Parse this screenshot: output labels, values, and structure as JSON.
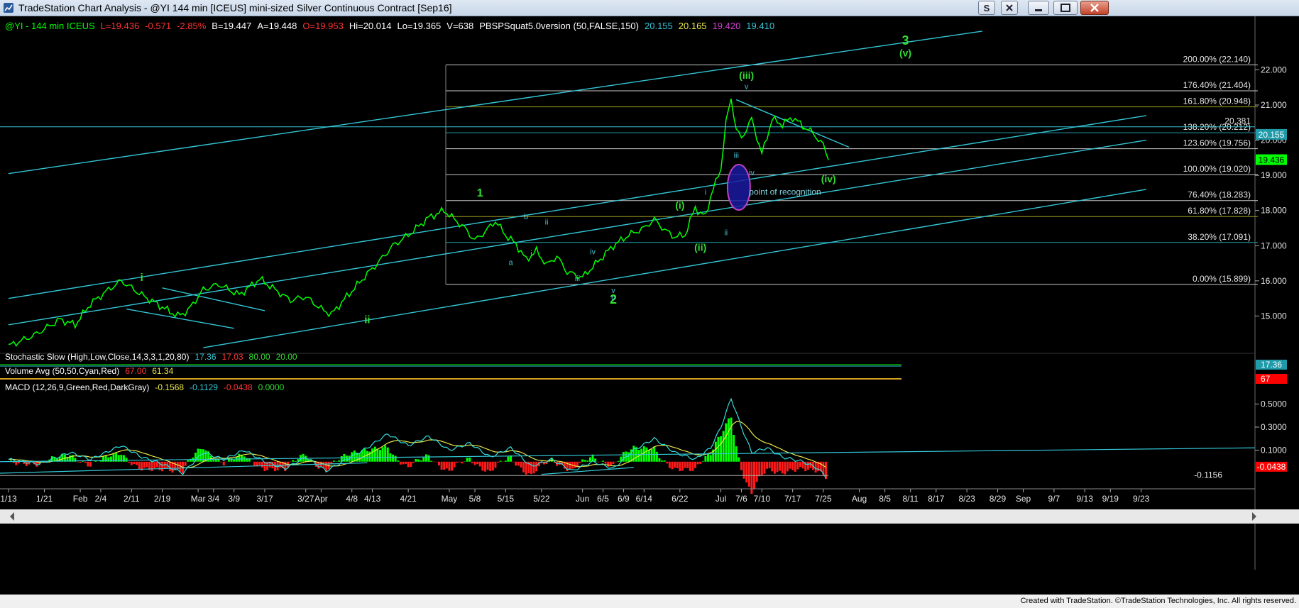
{
  "window": {
    "title": "TradeStation Chart Analysis - @YI 144 min [ICEUS] mini-sized Silver Continuous Contract [Sep16]",
    "footer_credit": "Created with TradeStation. ©TradeStation Technologies, Inc. All rights reserved."
  },
  "colors": {
    "background": "#000000",
    "price": "#00ff00",
    "channel": "#33c6d6",
    "fib_line": "#c8c8c8",
    "fib_line_olive": "#9c9c20",
    "fib_line_teal": "#1f9aa8",
    "wave_major": "#33dd33",
    "wave_minor": "#44bfd0",
    "macd_line": "#33dddd",
    "signal_line": "#e8e84a",
    "hist_pos": "#00ff00",
    "hist_neg": "#ff1a1a"
  },
  "header": [
    {
      "text": "@YI - 144 min ICEUS",
      "color": "#00ff00"
    },
    {
      "text": "L=19.436",
      "color": "#ff3333"
    },
    {
      "text": "-0.571",
      "color": "#ff3333"
    },
    {
      "text": "-2.85%",
      "color": "#ff3333"
    },
    {
      "text": "B=19.447",
      "color": "#ffffff"
    },
    {
      "text": "A=19.448",
      "color": "#ffffff"
    },
    {
      "text": "O=19.953",
      "color": "#ff3333"
    },
    {
      "text": "Hi=20.014",
      "color": "#ffffff"
    },
    {
      "text": "Lo=19.365",
      "color": "#ffffff"
    },
    {
      "text": "V=638",
      "color": "#ffffff"
    },
    {
      "text": "PBSPSquat5.0version (50,FALSE,150)",
      "color": "#ffffff"
    },
    {
      "text": "20.155",
      "color": "#33c6d6"
    },
    {
      "text": "20.165",
      "color": "#e8e84a"
    },
    {
      "text": "19.420",
      "color": "#d040d0"
    },
    {
      "text": "19.410",
      "color": "#33c6d6"
    }
  ],
  "chart_data": {
    "type": "line",
    "symbol": "@YI",
    "interval": "144 min",
    "price_axis": {
      "ticks": [
        15.0,
        16.0,
        17.0,
        18.0,
        19.0,
        20.0,
        21.0,
        22.0
      ],
      "ylim": [
        14.0,
        23.3
      ],
      "tick_labels": [
        "15.000",
        "16.000",
        "17.000",
        "18.000",
        "19.000",
        "20.000",
        "21.000",
        "22.000"
      ]
    },
    "price_markers": [
      {
        "label": "20.155",
        "value": 20.155,
        "bg": "#1f9aa8",
        "fg": "#ffffff"
      },
      {
        "label": "19.436",
        "value": 19.436,
        "bg": "#00ff00",
        "fg": "#000000"
      }
    ],
    "x_ticks": [
      "1/13",
      "1/21",
      "Feb",
      "2/4",
      "2/11",
      "2/19",
      "Mar",
      "3/4",
      "3/9",
      "3/17",
      "3/27",
      "Apr",
      "4/8",
      "4/13",
      "4/21",
      "May",
      "5/8",
      "5/15",
      "5/22",
      "Jun",
      "6/5",
      "6/9",
      "6/14",
      "6/22",
      "Jul",
      "7/6",
      "7/10",
      "7/17",
      "7/25",
      "Aug",
      "8/5",
      "8/11",
      "8/17",
      "8/23",
      "8/29",
      "Sep",
      "9/7",
      "9/13",
      "9/19",
      "9/23"
    ],
    "x_tick_index": [
      0,
      7,
      14,
      18,
      24,
      30,
      37,
      40,
      44,
      50,
      58,
      61,
      67,
      71,
      78,
      86,
      91,
      97,
      104,
      112,
      116,
      120,
      124,
      131,
      139,
      143,
      147,
      153,
      159,
      166,
      171,
      176,
      181,
      187,
      193,
      198,
      204,
      210,
      215,
      221
    ],
    "price_series": [
      {
        "i": 0,
        "y": 14.15
      },
      {
        "i": 5,
        "y": 14.45
      },
      {
        "i": 10,
        "y": 14.9
      },
      {
        "i": 13,
        "y": 14.75
      },
      {
        "i": 16,
        "y": 15.35
      },
      {
        "i": 20,
        "y": 15.8
      },
      {
        "i": 22,
        "y": 16.0
      },
      {
        "i": 26,
        "y": 15.6
      },
      {
        "i": 30,
        "y": 15.25
      },
      {
        "i": 33,
        "y": 15.0
      },
      {
        "i": 35,
        "y": 15.15
      },
      {
        "i": 38,
        "y": 15.75
      },
      {
        "i": 41,
        "y": 15.9
      },
      {
        "i": 45,
        "y": 15.6
      },
      {
        "i": 49,
        "y": 16.05
      },
      {
        "i": 52,
        "y": 15.75
      },
      {
        "i": 55,
        "y": 15.45
      },
      {
        "i": 58,
        "y": 15.55
      },
      {
        "i": 61,
        "y": 15.2
      },
      {
        "i": 63,
        "y": 15.05
      },
      {
        "i": 66,
        "y": 15.55
      },
      {
        "i": 70,
        "y": 16.2
      },
      {
        "i": 72,
        "y": 16.5
      },
      {
        "i": 75,
        "y": 17.0
      },
      {
        "i": 78,
        "y": 17.3
      },
      {
        "i": 80,
        "y": 17.55
      },
      {
        "i": 82,
        "y": 17.8
      },
      {
        "i": 85,
        "y": 18.0
      },
      {
        "i": 87,
        "y": 17.75
      },
      {
        "i": 89,
        "y": 17.5
      },
      {
        "i": 91,
        "y": 17.15
      },
      {
        "i": 93,
        "y": 17.4
      },
      {
        "i": 95,
        "y": 17.7
      },
      {
        "i": 97,
        "y": 17.3
      },
      {
        "i": 99,
        "y": 17.05
      },
      {
        "i": 101,
        "y": 16.6
      },
      {
        "i": 103,
        "y": 16.85
      },
      {
        "i": 105,
        "y": 16.45
      },
      {
        "i": 107,
        "y": 16.7
      },
      {
        "i": 109,
        "y": 16.25
      },
      {
        "i": 112,
        "y": 16.1
      },
      {
        "i": 115,
        "y": 16.55
      },
      {
        "i": 118,
        "y": 17.0
      },
      {
        "i": 121,
        "y": 17.3
      },
      {
        "i": 124,
        "y": 17.5
      },
      {
        "i": 126,
        "y": 17.75
      },
      {
        "i": 128,
        "y": 17.45
      },
      {
        "i": 130,
        "y": 17.25
      },
      {
        "i": 132,
        "y": 17.3
      },
      {
        "i": 134,
        "y": 18.1
      },
      {
        "i": 135,
        "y": 17.9
      },
      {
        "i": 136,
        "y": 17.85
      },
      {
        "i": 137,
        "y": 18.4
      },
      {
        "i": 139,
        "y": 19.2
      },
      {
        "i": 140,
        "y": 20.5
      },
      {
        "i": 141,
        "y": 21.2
      },
      {
        "i": 142,
        "y": 20.3
      },
      {
        "i": 143,
        "y": 20.05
      },
      {
        "i": 145,
        "y": 20.6
      },
      {
        "i": 147,
        "y": 19.6
      },
      {
        "i": 149,
        "y": 20.6
      },
      {
        "i": 151,
        "y": 20.45
      },
      {
        "i": 153,
        "y": 20.65
      },
      {
        "i": 155,
        "y": 20.4
      },
      {
        "i": 157,
        "y": 20.2
      },
      {
        "i": 159,
        "y": 19.85
      },
      {
        "i": 160,
        "y": 19.436
      }
    ],
    "fib_levels": [
      {
        "label": "200.00% (22.140)",
        "value": 22.14,
        "style": "fib_line"
      },
      {
        "label": "176.40% (21.404)",
        "value": 21.404,
        "style": "fib_line"
      },
      {
        "label": "161.80% (20.948)",
        "value": 20.948,
        "style": "fib_line_olive"
      },
      {
        "label": "138.20% (20.212)",
        "value": 20.212,
        "style": "fib_line_teal"
      },
      {
        "label": "123.60% (19.756)",
        "value": 19.756,
        "style": "fib_line"
      },
      {
        "label": "100.00% (19.020)",
        "value": 19.02,
        "style": "fib_line"
      },
      {
        "label": "76.40% (18.283)",
        "value": 18.283,
        "style": "fib_line"
      },
      {
        "label": "61.80% (17.828)",
        "value": 17.828,
        "style": "fib_line_olive"
      },
      {
        "label": "38.20% (17.091)",
        "value": 17.091,
        "style": "fib_line_teal"
      },
      {
        "label": "0.00% (15.899)",
        "value": 15.899,
        "style": "fib_line"
      }
    ],
    "horizontal_line": {
      "label": "20.381",
      "value": 20.381
    },
    "channels": [
      {
        "from": {
          "i": 0,
          "y": 19.05
        },
        "to": {
          "i": 190,
          "y": 23.1
        }
      },
      {
        "from": {
          "i": 0,
          "y": 15.5
        },
        "to": {
          "i": 222,
          "y": 20.7
        }
      },
      {
        "from": {
          "i": 0,
          "y": 14.75
        },
        "to": {
          "i": 222,
          "y": 20.0
        }
      },
      {
        "from": {
          "i": 38,
          "y": 14.1
        },
        "to": {
          "i": 222,
          "y": 18.6
        }
      },
      {
        "from": {
          "i": 23,
          "y": 15.2
        },
        "to": {
          "i": 44,
          "y": 14.65
        }
      },
      {
        "from": {
          "i": 30,
          "y": 15.8
        },
        "to": {
          "i": 50,
          "y": 15.15
        }
      },
      {
        "from": {
          "i": 142,
          "y": 21.15
        },
        "to": {
          "i": 164,
          "y": 19.8
        }
      }
    ],
    "wave_labels": [
      {
        "text": "3",
        "i": 175,
        "y": 22.72,
        "color": "wave_major",
        "size": 18
      },
      {
        "text": "(v)",
        "i": 175,
        "y": 22.38,
        "color": "wave_major",
        "size": 14
      },
      {
        "text": "(iii)",
        "i": 144,
        "y": 21.75,
        "color": "wave_major",
        "size": 14
      },
      {
        "text": "v",
        "i": 144,
        "y": 21.45,
        "color": "wave_minor",
        "size": 11
      },
      {
        "text": "1",
        "i": 92,
        "y": 18.4,
        "color": "wave_major",
        "size": 16
      },
      {
        "text": "(i)",
        "i": 131,
        "y": 18.05,
        "color": "wave_major",
        "size": 14
      },
      {
        "text": "(ii)",
        "i": 135,
        "y": 16.85,
        "color": "wave_major",
        "size": 14
      },
      {
        "text": "(iv)",
        "i": 160,
        "y": 18.8,
        "color": "wave_major",
        "size": 14
      },
      {
        "text": "2",
        "i": 118,
        "y": 15.35,
        "color": "wave_major",
        "size": 18
      },
      {
        "text": "ii",
        "i": 70,
        "y": 14.8,
        "color": "wave_major",
        "size": 15
      },
      {
        "text": "i",
        "i": 26,
        "y": 16.0,
        "color": "wave_major",
        "size": 15
      },
      {
        "text": "a",
        "i": 98,
        "y": 16.45,
        "color": "wave_minor",
        "size": 11
      },
      {
        "text": "b",
        "i": 101,
        "y": 17.75,
        "color": "wave_minor",
        "size": 11
      },
      {
        "text": "c",
        "i": 118,
        "y": 15.45,
        "color": "wave_minor",
        "size": 11
      },
      {
        "text": "i",
        "i": 102,
        "y": 16.7,
        "color": "wave_minor",
        "size": 11
      },
      {
        "text": "ii",
        "i": 105,
        "y": 17.6,
        "color": "wave_minor",
        "size": 11
      },
      {
        "text": "iii",
        "i": 111,
        "y": 16.0,
        "color": "wave_minor",
        "size": 11
      },
      {
        "text": "iv",
        "i": 114,
        "y": 16.75,
        "color": "wave_minor",
        "size": 11
      },
      {
        "text": "v",
        "i": 118,
        "y": 15.65,
        "color": "wave_minor",
        "size": 11
      },
      {
        "text": "i",
        "i": 136,
        "y": 18.45,
        "color": "wave_minor",
        "size": 11
      },
      {
        "text": "ii",
        "i": 140,
        "y": 17.3,
        "color": "wave_minor",
        "size": 11
      },
      {
        "text": "iii",
        "i": 142,
        "y": 19.5,
        "color": "wave_minor",
        "size": 11
      },
      {
        "text": "iv",
        "i": 145,
        "y": 19.0,
        "color": "wave_minor",
        "size": 11
      }
    ],
    "annotation": {
      "text": "point of recognition",
      "i": 144.5,
      "y": 18.45
    },
    "ellipse": {
      "i": 142.5,
      "y": 18.66,
      "label": ""
    },
    "stochastic": {
      "label": "Stochastic Slow (High,Low,Close,14,3,3,1,20,80)",
      "values": [
        "17.36",
        "17.03",
        "80.00",
        "20.00"
      ],
      "value_colors": [
        "#33c6d6",
        "#ff3333",
        "#33dd33",
        "#33dd33"
      ],
      "axis_marker": "17.36"
    },
    "volume": {
      "label": "Volume Avg (50,50,Cyan,Red)",
      "values": [
        "67.00",
        "61.34"
      ],
      "value_colors": [
        "#ff3333",
        "#e8e84a"
      ],
      "axis_marker": "67"
    },
    "macd": {
      "label": "MACD (12,26,9,Green,Red,DarkGray)",
      "values": [
        "-0.1568",
        "-0.1129",
        "-0.0438",
        "0.0000"
      ],
      "value_colors": [
        "#e8e84a",
        "#33c6d6",
        "#ff3333",
        "#33dd33"
      ],
      "ticks": [
        0.5,
        0.3,
        0.1
      ],
      "tick_labels": [
        "0.5000",
        "0.3000",
        "0.1000"
      ],
      "ylim": [
        -0.18,
        0.62
      ],
      "axis_marker": "-0.0438",
      "level_line": {
        "label": "-0.1156",
        "value": -0.1156
      },
      "macd_series": [
        {
          "i": 0,
          "y": 0.02
        },
        {
          "i": 6,
          "y": -0.02
        },
        {
          "i": 12,
          "y": 0.08
        },
        {
          "i": 16,
          "y": 0.02
        },
        {
          "i": 22,
          "y": 0.14
        },
        {
          "i": 26,
          "y": 0.04
        },
        {
          "i": 30,
          "y": -0.02
        },
        {
          "i": 34,
          "y": -0.1
        },
        {
          "i": 38,
          "y": 0.08
        },
        {
          "i": 42,
          "y": 0.02
        },
        {
          "i": 46,
          "y": 0.1
        },
        {
          "i": 50,
          "y": 0.0
        },
        {
          "i": 54,
          "y": -0.06
        },
        {
          "i": 58,
          "y": 0.04
        },
        {
          "i": 62,
          "y": -0.08
        },
        {
          "i": 66,
          "y": 0.02
        },
        {
          "i": 70,
          "y": 0.12
        },
        {
          "i": 74,
          "y": 0.24
        },
        {
          "i": 78,
          "y": 0.14
        },
        {
          "i": 82,
          "y": 0.22
        },
        {
          "i": 86,
          "y": 0.1
        },
        {
          "i": 90,
          "y": 0.16
        },
        {
          "i": 94,
          "y": 0.04
        },
        {
          "i": 98,
          "y": 0.12
        },
        {
          "i": 102,
          "y": -0.04
        },
        {
          "i": 106,
          "y": 0.02
        },
        {
          "i": 110,
          "y": -0.08
        },
        {
          "i": 114,
          "y": 0.0
        },
        {
          "i": 118,
          "y": -0.06
        },
        {
          "i": 122,
          "y": 0.1
        },
        {
          "i": 126,
          "y": 0.2
        },
        {
          "i": 130,
          "y": 0.08
        },
        {
          "i": 134,
          "y": 0.02
        },
        {
          "i": 137,
          "y": 0.12
        },
        {
          "i": 139,
          "y": 0.3
        },
        {
          "i": 141,
          "y": 0.55
        },
        {
          "i": 143,
          "y": 0.3
        },
        {
          "i": 145,
          "y": 0.08
        },
        {
          "i": 148,
          "y": 0.12
        },
        {
          "i": 151,
          "y": 0.04
        },
        {
          "i": 155,
          "y": 0.0
        },
        {
          "i": 158,
          "y": -0.06
        },
        {
          "i": 160,
          "y": -0.1568
        }
      ]
    }
  }
}
